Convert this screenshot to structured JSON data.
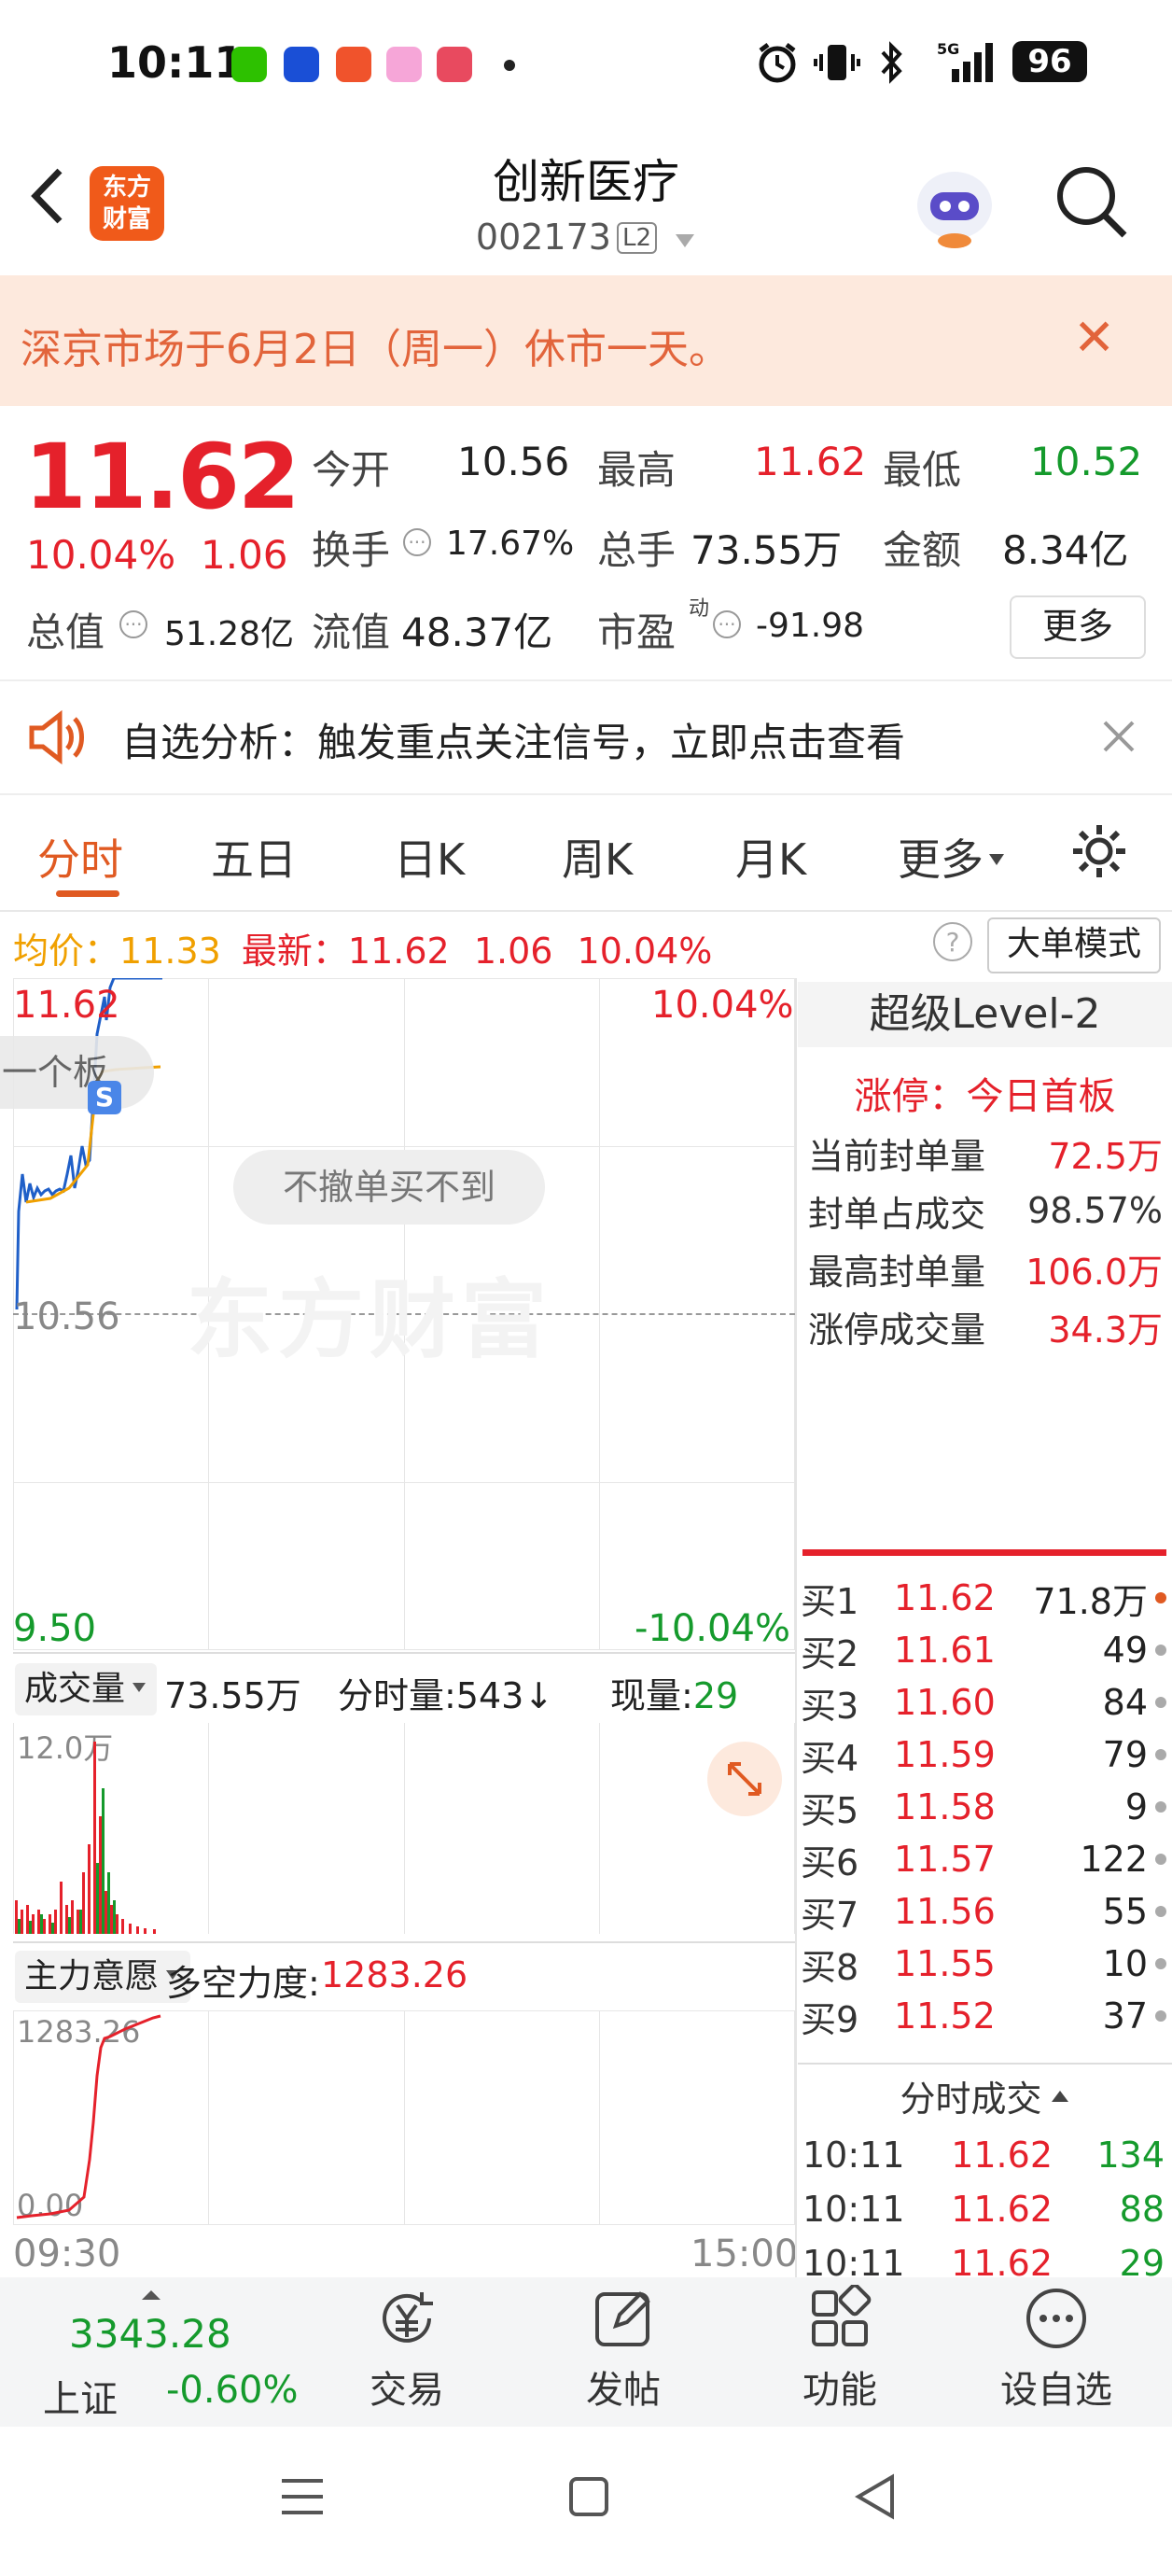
{
  "status_bar": {
    "time": "10:11",
    "battery": "96",
    "signal": "5G"
  },
  "header": {
    "logo_text_1": "东方",
    "logo_text_2": "财富",
    "title": "创新医疗",
    "code": "002173",
    "badge": "L2"
  },
  "notice": {
    "text": "深京市场于6月2日（周一）休市一天。"
  },
  "quote": {
    "price": "11.62",
    "change_pct": "10.04%",
    "change": "1.06",
    "open_label": "今开",
    "open": "10.56",
    "high_label": "最高",
    "high": "11.62",
    "low_label": "最低",
    "low": "10.52",
    "turnover_label": "换手",
    "turnover": "17.67%",
    "volume_label": "总手",
    "volume": "73.55万",
    "amount_label": "金额",
    "amount": "8.34亿",
    "mktcap_label": "总值",
    "mktcap": "51.28亿",
    "float_label": "流值",
    "float": "48.37亿",
    "pe_label": "市盈",
    "pe_sup": "动",
    "pe": "-91.98",
    "more": "更多"
  },
  "ad": {
    "text": "自选分析：触发重点关注信号，立即点击查看"
  },
  "tabs": [
    "分时",
    "五日",
    "日K",
    "周K",
    "月K",
    "更多"
  ],
  "info": {
    "avg_label": "均价：",
    "avg": "11.33",
    "latest_label": "最新：",
    "latest": "11.62",
    "chg": "1.06",
    "pct": "10.04%",
    "mode_btn": "大单模式"
  },
  "chart": {
    "top_price": "11.62",
    "top_pct": "10.04%",
    "mid_price": "10.56",
    "bottom_price": "9.50",
    "bottom_pct": "-10.04%",
    "pill": "不撤单买不到",
    "overlay_text": "一个板",
    "watermark": "东方财富",
    "start_time": "09:30",
    "end_time": "15:00"
  },
  "volume": {
    "label": "成交量",
    "total": "73.55万",
    "minute_label": "分时量:543↓",
    "now_label": "现量:",
    "now": "29",
    "max": "12.0万"
  },
  "indicator": {
    "label": "主力意愿",
    "name": "多空力度:",
    "value": "1283.26",
    "top": "1283.26",
    "bottom": "0.00"
  },
  "right_panel": {
    "title": "超级Level-2",
    "limit_label": "涨停：今日首板",
    "stats": [
      {
        "label": "当前封单量",
        "value": "72.5万",
        "red": true
      },
      {
        "label": "封单占成交",
        "value": "98.57%",
        "red": false
      },
      {
        "label": "最高封单量",
        "value": "106.0万",
        "red": true
      },
      {
        "label": "涨停成交量",
        "value": "34.3万",
        "red": true
      }
    ],
    "bids": [
      {
        "name": "买1",
        "price": "11.62",
        "vol": "71.8万"
      },
      {
        "name": "买2",
        "price": "11.61",
        "vol": "49"
      },
      {
        "name": "买3",
        "price": "11.60",
        "vol": "84"
      },
      {
        "name": "买4",
        "price": "11.59",
        "vol": "79"
      },
      {
        "name": "买5",
        "price": "11.58",
        "vol": "9"
      },
      {
        "name": "买6",
        "price": "11.57",
        "vol": "122"
      },
      {
        "name": "买7",
        "price": "11.56",
        "vol": "55"
      },
      {
        "name": "买8",
        "price": "11.55",
        "vol": "10"
      },
      {
        "name": "买9",
        "price": "11.52",
        "vol": "37"
      }
    ],
    "trades_label": "分时成交",
    "trades": [
      {
        "time": "10:11",
        "price": "11.62",
        "vol": "134"
      },
      {
        "time": "10:11",
        "price": "11.62",
        "vol": "88"
      },
      {
        "time": "10:11",
        "price": "11.62",
        "vol": "29"
      }
    ]
  },
  "bottom_nav": {
    "index_value": "3343.28",
    "index_name": "上证",
    "index_pct": "-0.60%",
    "items": [
      "交易",
      "发帖",
      "功能",
      "设自选"
    ]
  }
}
